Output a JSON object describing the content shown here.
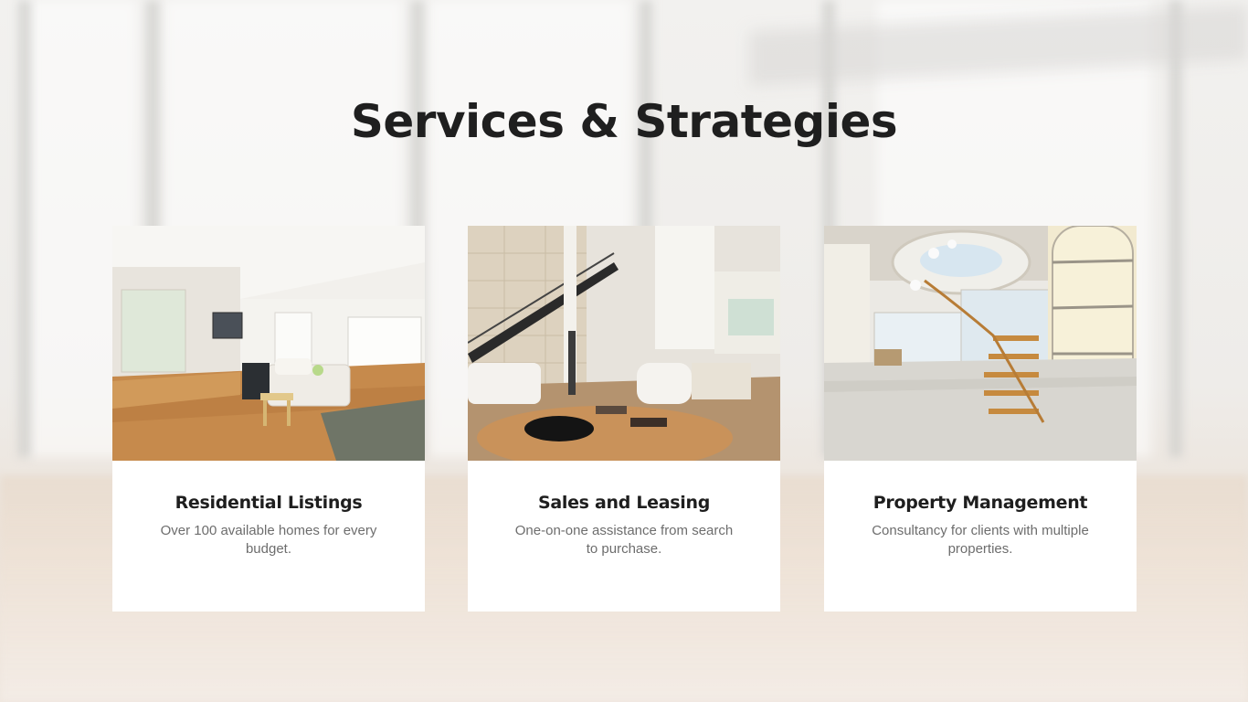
{
  "header": {
    "title": "Services & Strategies"
  },
  "cards": [
    {
      "name": "Residential Listings",
      "description": "Over 100 available homes for every budget."
    },
    {
      "name": "Sales and Leasing",
      "description": "One-on-one assistance from search to purchase."
    },
    {
      "name": "Property Management",
      "description": "Consultancy for clients with multiple properties."
    }
  ]
}
